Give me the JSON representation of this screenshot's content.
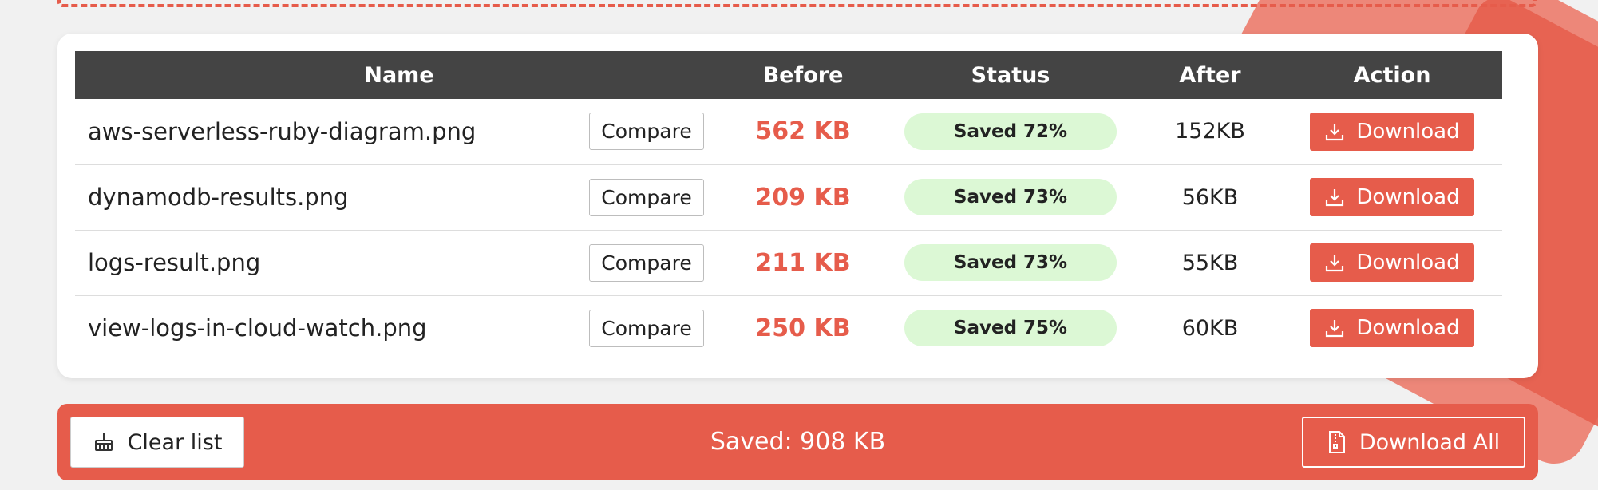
{
  "colors": {
    "accent": "#e65c4b",
    "header_bg": "#444444",
    "status_bg": "#dcf8d5"
  },
  "table": {
    "headers": {
      "name": "Name",
      "before": "Before",
      "status": "Status",
      "after": "After",
      "action": "Action"
    },
    "rows": [
      {
        "name": "aws-serverless-ruby-diagram.png",
        "compare": "Compare",
        "before": "562 KB",
        "status": "Saved 72%",
        "after": "152KB",
        "action": "Download"
      },
      {
        "name": "dynamodb-results.png",
        "compare": "Compare",
        "before": "209 KB",
        "status": "Saved 73%",
        "after": "56KB",
        "action": "Download"
      },
      {
        "name": "logs-result.png",
        "compare": "Compare",
        "before": "211 KB",
        "status": "Saved 73%",
        "after": "55KB",
        "action": "Download"
      },
      {
        "name": "view-logs-in-cloud-watch.png",
        "compare": "Compare",
        "before": "250 KB",
        "status": "Saved 75%",
        "after": "60KB",
        "action": "Download"
      }
    ]
  },
  "footer": {
    "clear_label": "Clear list",
    "clear_icon": "broom-icon",
    "saved_text": "Saved: 908 KB",
    "download_all_label": "Download All",
    "download_all_icon": "zip-file-icon"
  }
}
